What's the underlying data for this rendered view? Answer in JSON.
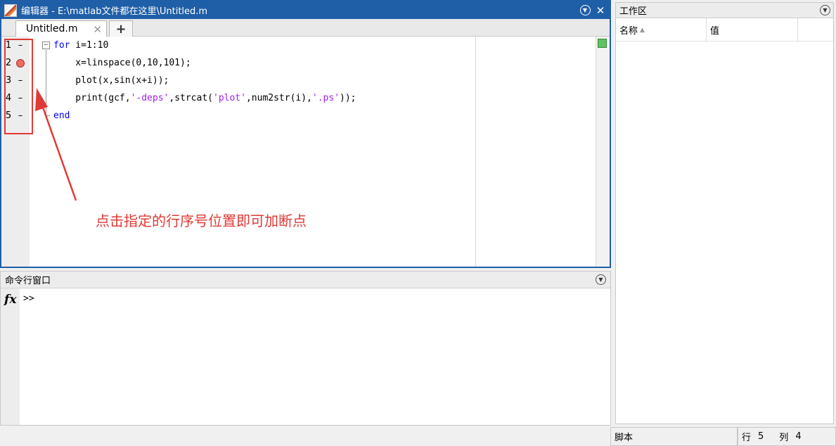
{
  "editor": {
    "title": "编辑器 - E:\\matlab文件都在这里\\Untitled.m",
    "tab_label": "Untitled.m",
    "line_numbers": [
      "1",
      "2",
      "3",
      "4",
      "5"
    ],
    "breakpoint_line": "2",
    "code": [
      {
        "keyword": "for",
        "rest": " i=1:10"
      },
      {
        "text": "    x=linspace(0,10,101);"
      },
      {
        "text": "    plot(x,sin(x+i));"
      },
      {
        "p1": "    print(gcf,",
        "s1": "'-deps'",
        "p2": ",strcat(",
        "s2": "'plot'",
        "p3": ",num2str(i),",
        "s3": "'.ps'",
        "p4": "));"
      },
      {
        "keyword": "end"
      }
    ],
    "annotation": "点击指定的行序号位置即可加断点"
  },
  "command_window": {
    "title": "命令行窗口",
    "fx_label": "fx",
    "prompt": ">>"
  },
  "workspace": {
    "title": "工作区",
    "columns": [
      "名称",
      "值"
    ]
  },
  "statusbar": {
    "type": "脚本",
    "row_label": "行",
    "row_value": "5",
    "col_label": "列",
    "col_value": "4"
  },
  "colors": {
    "title_bar": "#1f5fa8",
    "keyword": "#0000ff",
    "string": "#a020f0",
    "annotation": "#e03a36",
    "breakpoint": "#ef6b5f"
  },
  "icons": [
    "matlab-editor-icon",
    "panel-menu-icon",
    "close-icon",
    "tab-close-icon",
    "add-tab-icon",
    "fold-icon",
    "breakpoint-icon",
    "fx-icon",
    "sort-ascending-icon",
    "annotation-arrow"
  ]
}
